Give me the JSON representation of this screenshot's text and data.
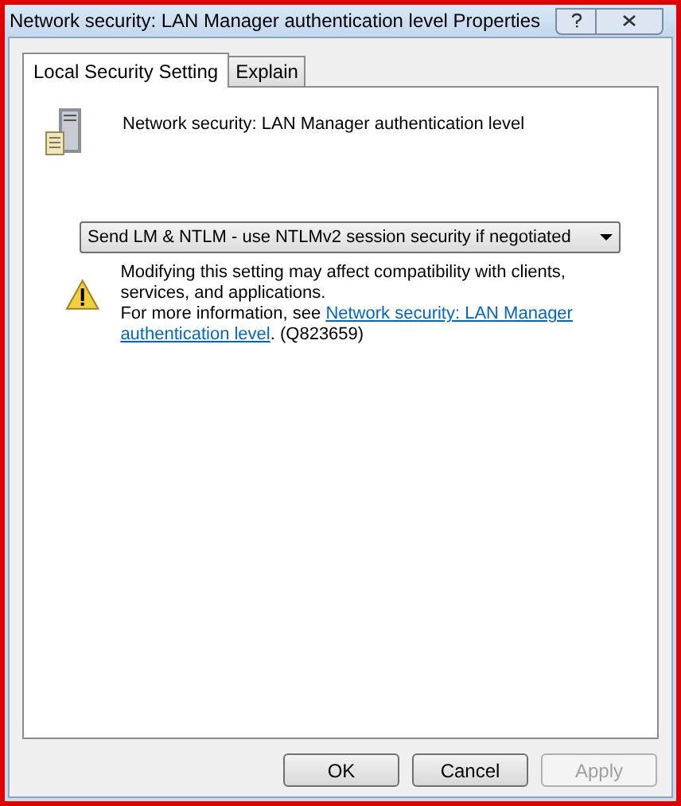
{
  "window": {
    "title": "Network security: LAN Manager authentication level Properties"
  },
  "tabs": [
    {
      "label": "Local Security Setting",
      "selected": true
    },
    {
      "label": "Explain",
      "selected": false
    }
  ],
  "policy": {
    "name": "Network security: LAN Manager authentication level"
  },
  "dropdown": {
    "value": "Send LM & NTLM - use NTLMv2 session security if negotiated"
  },
  "warning": {
    "text": "Modifying this setting may affect compatibility with clients, services, and applications.",
    "more_prefix": "For more information, see",
    "link_lines": [
      "Network security: LAN Manager",
      "authentication level"
    ],
    "suffix": ". (Q823659)"
  },
  "buttons": [
    {
      "label": "OK",
      "disabled": false
    },
    {
      "label": "Cancel",
      "disabled": false
    },
    {
      "label": "Apply",
      "disabled": true
    }
  ]
}
